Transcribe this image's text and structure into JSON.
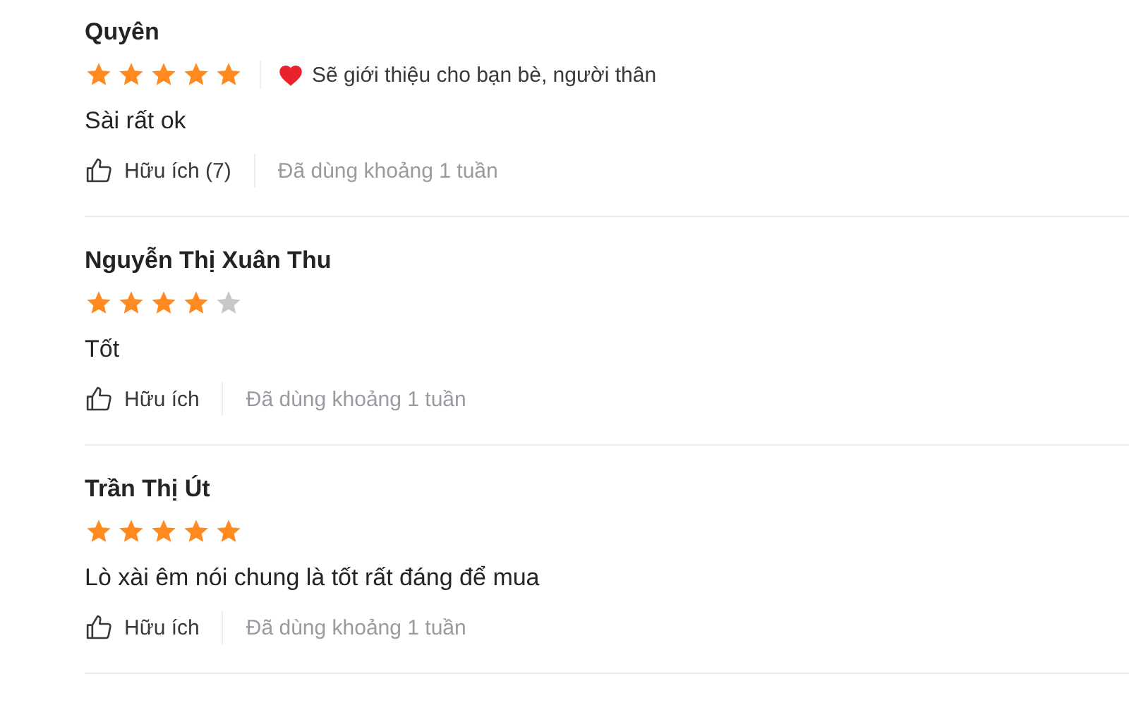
{
  "reviews": [
    {
      "name": "Quyên",
      "stars": 5,
      "recommendation": "Sẽ giới thiệu cho bạn bè, người thân",
      "text": "Sài rất ok",
      "helpful": "Hữu ích (7)",
      "usage": "Đã dùng khoảng 1 tuần"
    },
    {
      "name": "Nguyễn Thị Xuân Thu",
      "stars": 4,
      "text": "Tốt",
      "helpful": "Hữu ích",
      "usage": "Đã dùng khoảng 1 tuần"
    },
    {
      "name": "Trần Thị Út",
      "stars": 5,
      "text": "Lò xài êm nói chung là tốt rất đáng để mua",
      "helpful": "Hữu ích",
      "usage": "Đã dùng khoảng 1 tuần"
    }
  ]
}
